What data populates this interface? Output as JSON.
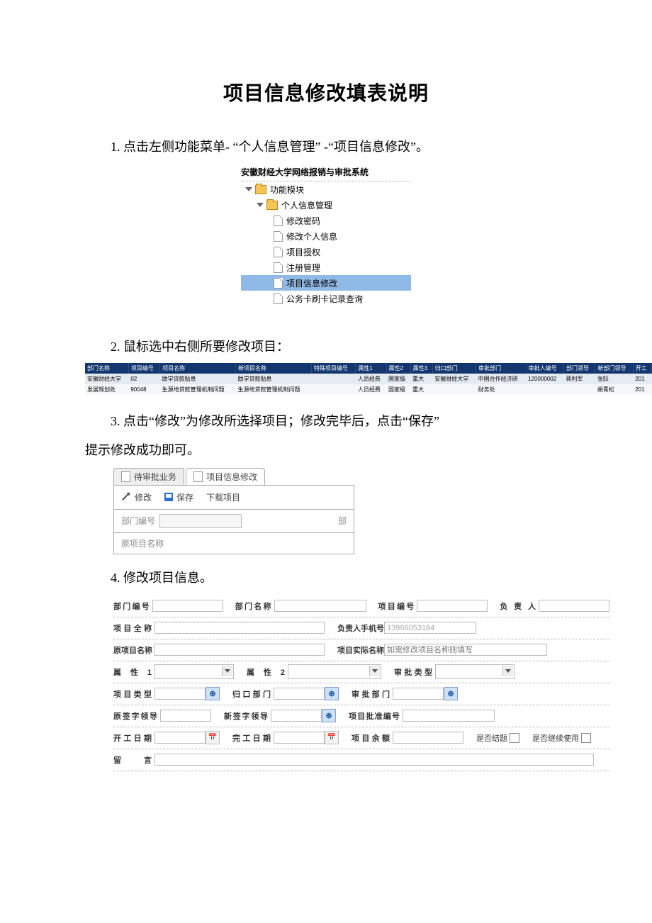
{
  "title": "项目信息修改填表说明",
  "steps": {
    "s1": "1. 点击左侧功能菜单- “个人信息管理” -“项目信息修改”。",
    "s2": "2. 鼠标选中右侧所要修改项目：",
    "s3": "3. 点击“修改”为修改所选择项目；修改完毕后，点击“保存”提示修改成功即可。",
    "s3a": "3. 点击“修改”为修改所选择项目；修改完毕后，点击“保存”",
    "s3b": "提示修改成功即可。",
    "s4": "4. 修改项目信息。"
  },
  "tree": {
    "system_title": "安徽财经大学网络报销与审批系统",
    "root": "功能模块",
    "group": "个人信息管理",
    "items": [
      {
        "label": "修改密码"
      },
      {
        "label": "修改个人信息"
      },
      {
        "label": "项目授权"
      },
      {
        "label": "注册管理"
      },
      {
        "label": "项目信息修改",
        "selected": true
      },
      {
        "label": "公务卡刷卡记录查询"
      }
    ]
  },
  "table": {
    "headers": [
      "部门名称",
      "项目编号",
      "项目名称",
      "新项目名称",
      "特殊项目编号",
      "属性1",
      "属性2",
      "属性3",
      "归口部门",
      "审批部门",
      "审批人编号",
      "部门领导",
      "新部门领导",
      "开工"
    ],
    "rows": [
      [
        "安徽财经大学",
        "02",
        "助学贷款贴息",
        "助学贷款贴息",
        "",
        "人员经费",
        "国家级",
        "重大",
        "安徽财经大学",
        "中国合作经济研",
        "120000002",
        "蒋利军",
        "张跃",
        "201"
      ],
      [
        "发展规划处",
        "90048",
        "生源地贷款管理机制问题",
        "生源地贷款管理机制问题",
        "",
        "人员经费",
        "国家级",
        "重大",
        "",
        "财务处",
        "",
        "",
        "胡青松",
        "201"
      ]
    ]
  },
  "toolbar": {
    "tabs": {
      "pending": "待审批业务",
      "edit": "项目信息修改"
    },
    "btn_edit": "修改",
    "btn_save": "保存",
    "btn_download": "下载项目",
    "dept_no_label": "部门编号",
    "dept_label": "部",
    "orig_name_label": "原项目名称"
  },
  "form": {
    "labels": {
      "dept_no": "部门编号",
      "dept_name": "部门名称",
      "proj_no": "项目编号",
      "owner": "负 责 人",
      "proj_full": "项目全称",
      "owner_phone": "负责人手机号",
      "orig_name": "原项目名称",
      "actual_name": "项目实际名称",
      "attr1": "属 性 1",
      "attr2": "属 性 2",
      "review_type": "审批类型",
      "proj_type": "项目类型",
      "home_dept": "归口部门",
      "review_dept": "审批部门",
      "orig_sign": "原签字领导",
      "new_sign": "新签字领导",
      "approval_no": "项目批准编号",
      "start_date": "开工日期",
      "end_date": "完工日期",
      "balance": "项目余额",
      "is_closed": "是否结题",
      "cont_use": "是否继续使用",
      "remark": "留    言"
    },
    "values": {
      "owner_phone": "13966053184",
      "actual_name_placeholder": "如需修改项目名称则填写"
    }
  }
}
